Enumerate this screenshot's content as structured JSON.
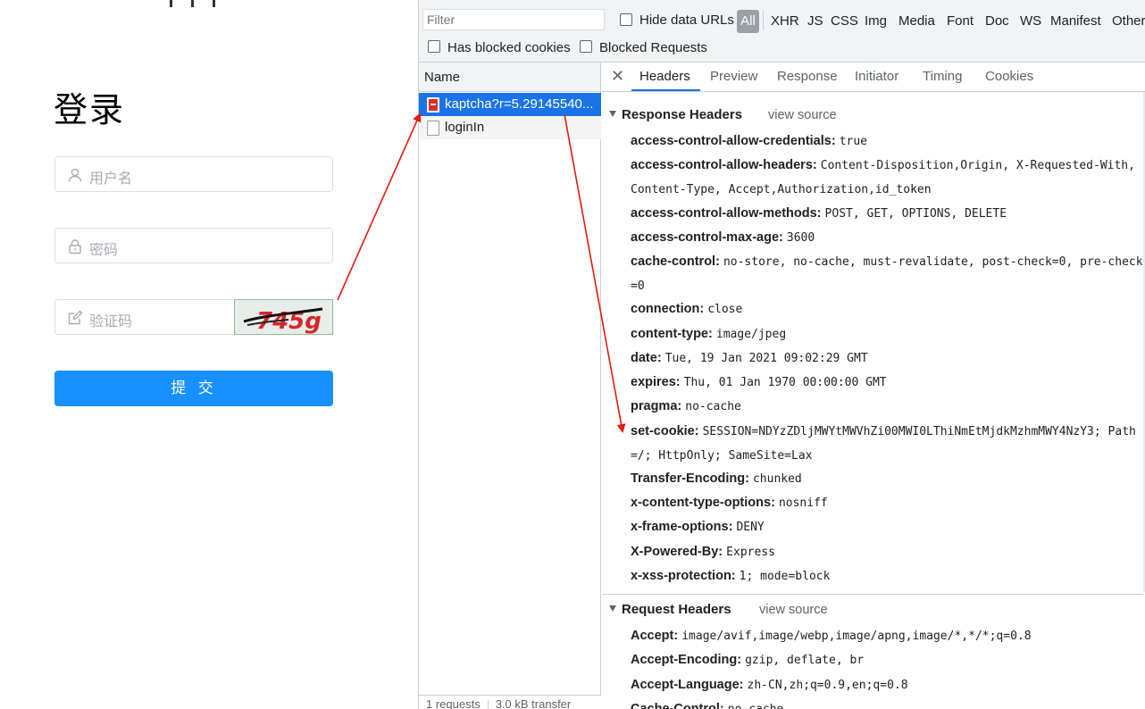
{
  "login": {
    "title": "登录",
    "username_placeholder": "用户名",
    "password_placeholder": "密码",
    "captcha_placeholder": "验证码",
    "captcha_text": "745g",
    "submit_label": "提 交"
  },
  "devtools": {
    "filter_placeholder": "Filter",
    "hide_data_urls_label": "Hide data URLs",
    "type_filters": [
      "All",
      "XHR",
      "JS",
      "CSS",
      "Img",
      "Media",
      "Font",
      "Doc",
      "WS",
      "Manifest",
      "Other"
    ],
    "has_blocked_cookies_label": "Has blocked cookies",
    "blocked_requests_label": "Blocked Requests",
    "name_header": "Name",
    "requests": [
      "kaptcha?r=5.29145540...",
      "loginIn"
    ],
    "status_bar": [
      "1 requests",
      "3.0 kB transfer"
    ],
    "tabs": [
      "Headers",
      "Preview",
      "Response",
      "Initiator",
      "Timing",
      "Cookies"
    ],
    "active_tab": "Headers",
    "response_headers_title": "Response Headers",
    "request_headers_title": "Request Headers",
    "view_source_label": "view source",
    "response_headers": [
      {
        "key": "access-control-allow-credentials:",
        "value": "true"
      },
      {
        "key": "access-control-allow-headers:",
        "value": "Content-Disposition,Origin, X-Requested-With, Content-Type, Accept,Authorization,id_token"
      },
      {
        "key": "access-control-allow-methods:",
        "value": "POST, GET, OPTIONS, DELETE"
      },
      {
        "key": "access-control-max-age:",
        "value": "3600"
      },
      {
        "key": "cache-control:",
        "value": "no-store, no-cache, must-revalidate, post-check=0, pre-check=0"
      },
      {
        "key": "connection:",
        "value": "close"
      },
      {
        "key": "content-type:",
        "value": "image/jpeg"
      },
      {
        "key": "date:",
        "value": "Tue, 19 Jan 2021 09:02:29 GMT"
      },
      {
        "key": "expires:",
        "value": "Thu, 01 Jan 1970 00:00:00 GMT"
      },
      {
        "key": "pragma:",
        "value": "no-cache"
      },
      {
        "key": "set-cookie:",
        "value": "SESSION=NDYzZDljMWYtMWVhZi00MWI0LThiNmEtMjdkMzhmMWY4NzY3; Path=/; HttpOnly; SameSite=Lax"
      },
      {
        "key": "Transfer-Encoding:",
        "value": "chunked"
      },
      {
        "key": "x-content-type-options:",
        "value": "nosniff"
      },
      {
        "key": "x-frame-options:",
        "value": "DENY"
      },
      {
        "key": "X-Powered-By:",
        "value": "Express"
      },
      {
        "key": "x-xss-protection:",
        "value": "1; mode=block"
      }
    ],
    "request_headers": [
      {
        "key": "Accept:",
        "value": "image/avif,image/webp,image/apng,image/*,*/*;q=0.8"
      },
      {
        "key": "Accept-Encoding:",
        "value": "gzip, deflate, br"
      },
      {
        "key": "Accept-Language:",
        "value": "zh-CN,zh;q=0.9,en;q=0.8"
      },
      {
        "key": "Cache-Control:",
        "value": "no-cache"
      }
    ]
  },
  "colors": {
    "submit_blue": "#1890ff",
    "selected_row": "#1a73e8",
    "annotation_red": "#e8190f"
  }
}
